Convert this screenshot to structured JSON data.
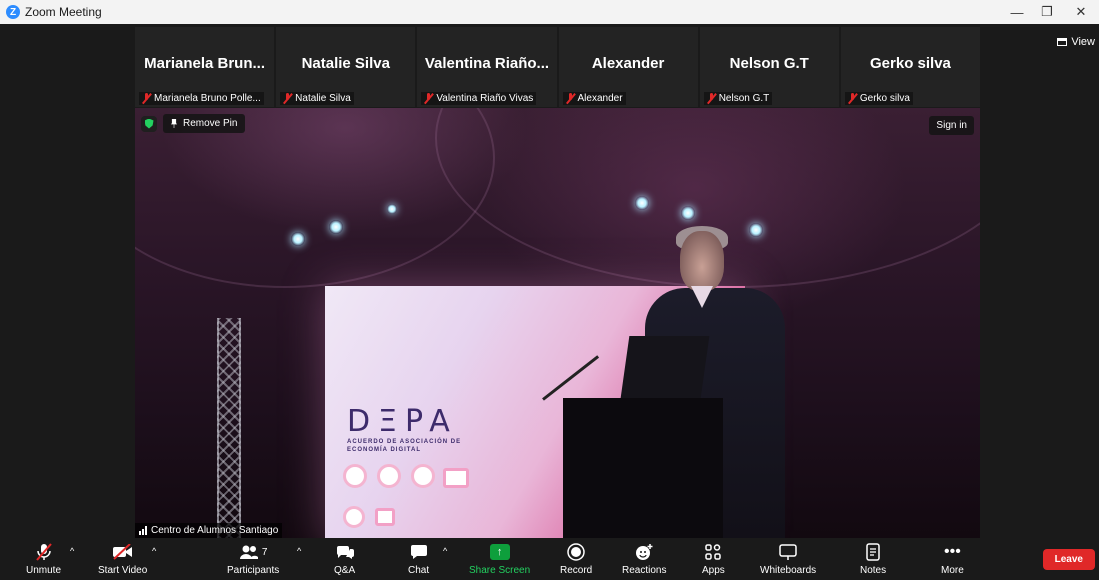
{
  "window": {
    "title": "Zoom Meeting",
    "app_icon": "zoom-logo-icon",
    "controls": [
      "minimize-icon",
      "restore-icon",
      "close-icon"
    ]
  },
  "view_button": {
    "label": "View"
  },
  "participants_strip": [
    {
      "display_name": "Marianela  Brun...",
      "name_tag": "Marianela Bruno Polle...",
      "muted": true
    },
    {
      "display_name": "Natalie Silva",
      "name_tag": "Natalie Silva",
      "muted": true
    },
    {
      "display_name": "Valentina  Riaño...",
      "name_tag": "Valentina Riaño Vivas",
      "muted": true
    },
    {
      "display_name": "Alexander",
      "name_tag": "Alexander",
      "muted": true
    },
    {
      "display_name": "Nelson G.T",
      "name_tag": "Nelson G.T",
      "muted": true
    },
    {
      "display_name": "Gerko silva",
      "name_tag": "Gerko silva",
      "muted": true
    }
  ],
  "main_video": {
    "remove_pin_label": "Remove Pin",
    "sign_in_label": "Sign in",
    "speaker_name": "Centro de Alumnos Santiago",
    "slide_logo": "DΞPA",
    "slide_subtitle": "ACUERDO DE ASOCIACIÓN DE ECONOMÍA DIGITAL",
    "security_color": "#23d160"
  },
  "toolbar": {
    "unmute": "Unmute",
    "start_video": "Start Video",
    "participants": "Participants",
    "participants_count": "7",
    "qa": "Q&A",
    "chat": "Chat",
    "share_screen": "Share Screen",
    "record": "Record",
    "reactions": "Reactions",
    "apps": "Apps",
    "whiteboards": "Whiteboards",
    "notes": "Notes",
    "more": "More",
    "leave": "Leave"
  },
  "colors": {
    "leave": "#e02828",
    "share": "#0e9f3c",
    "muted_icon": "#e02828",
    "background": "#1a1a1a"
  }
}
